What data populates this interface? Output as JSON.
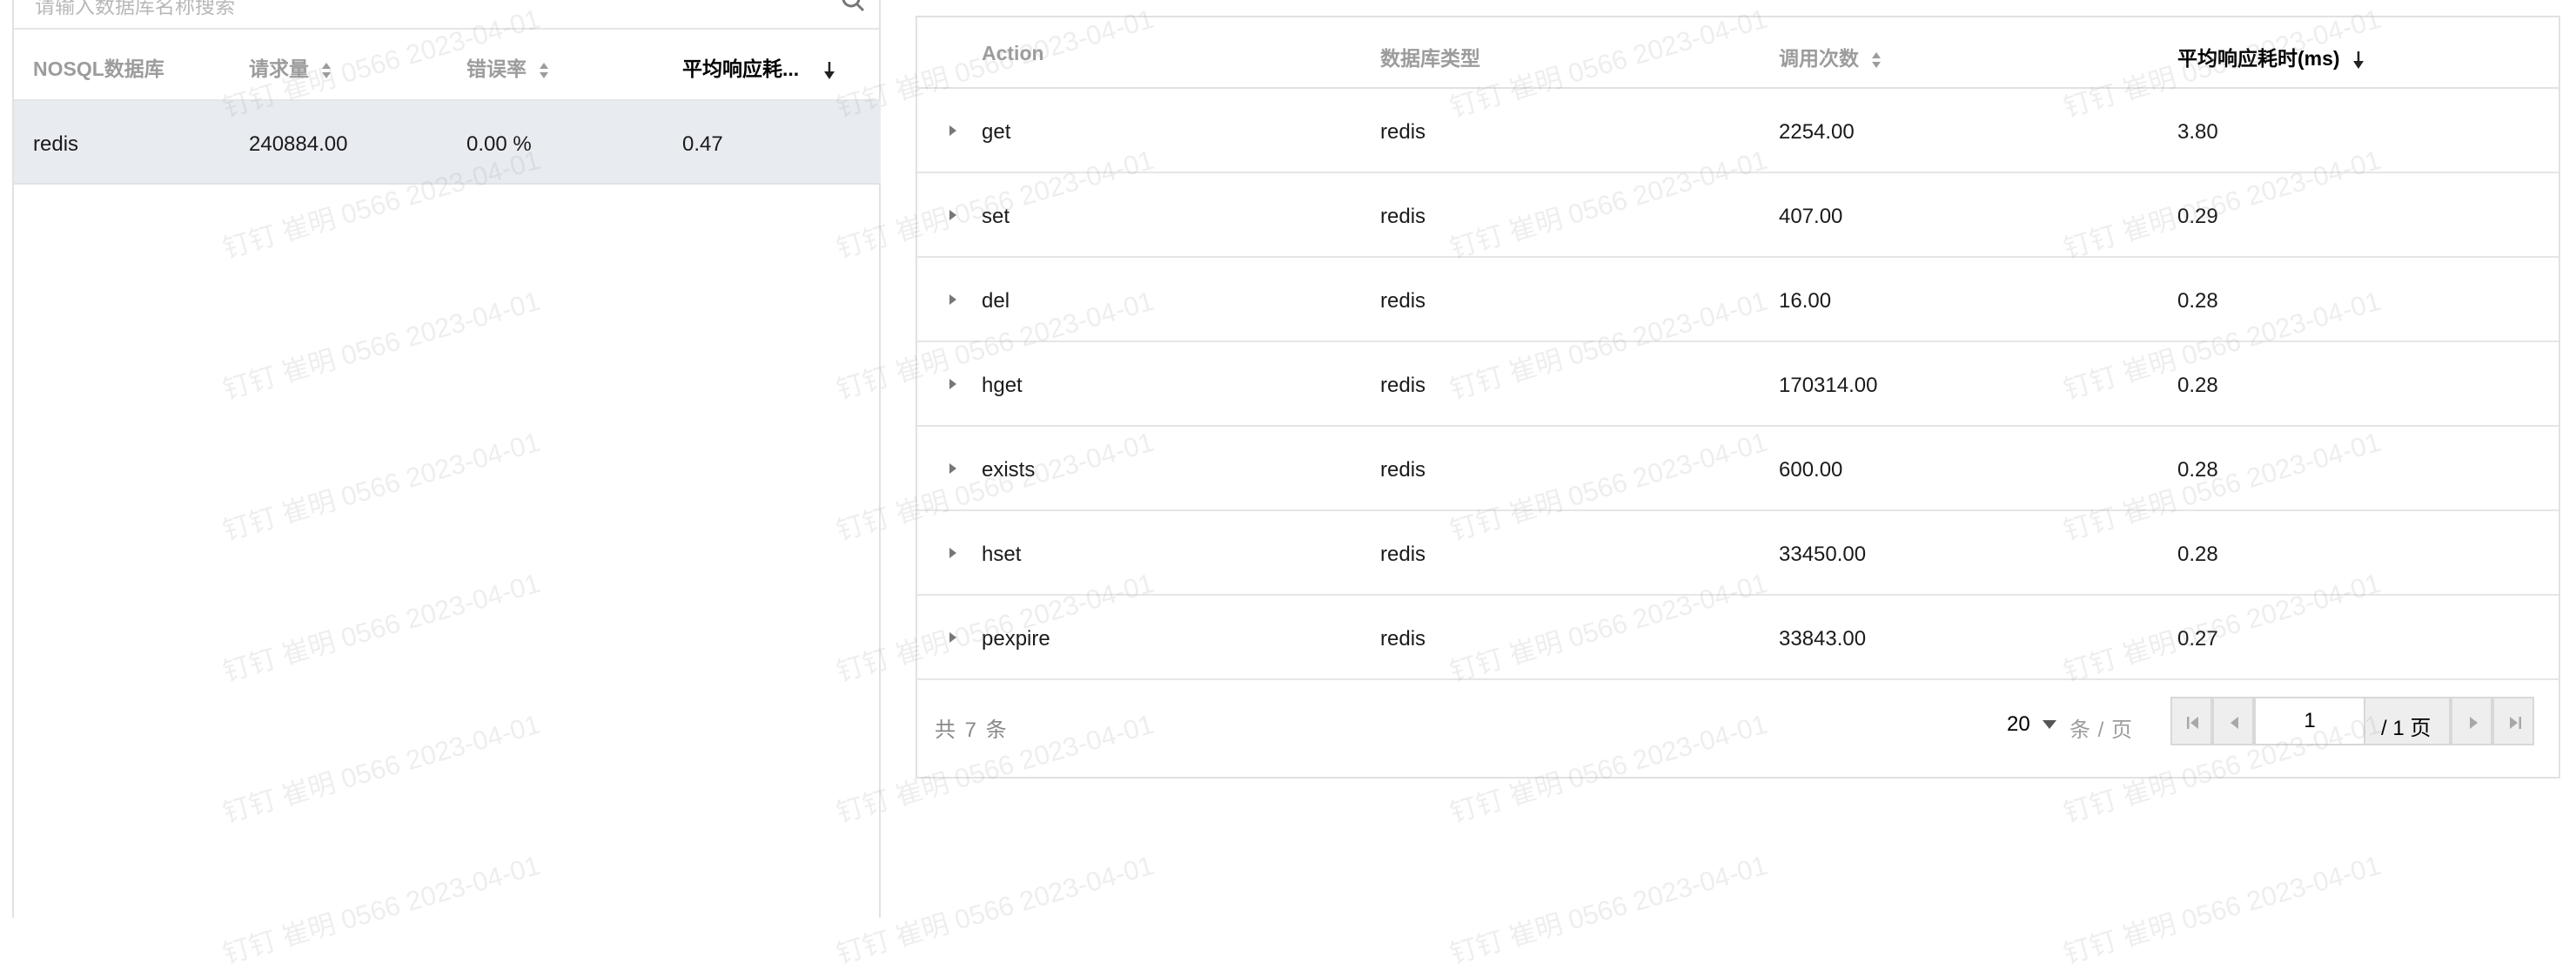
{
  "left": {
    "search_placeholder": "请输入数据库名称搜索",
    "columns": [
      "NOSQL数据库",
      "请求量",
      "错误率",
      "平均响应耗..."
    ],
    "rows": [
      {
        "name": "redis",
        "requests": "240884.00",
        "error_rate": "0.00 %",
        "avg_latency": "0.47"
      }
    ]
  },
  "right": {
    "columns": [
      "Action",
      "数据库类型",
      "调用次数",
      "平均响应耗时(ms)"
    ],
    "rows": [
      {
        "action": "get",
        "db_type": "redis",
        "calls": "2254.00",
        "avg_latency": "3.80"
      },
      {
        "action": "set",
        "db_type": "redis",
        "calls": "407.00",
        "avg_latency": "0.29"
      },
      {
        "action": "del",
        "db_type": "redis",
        "calls": "16.00",
        "avg_latency": "0.28"
      },
      {
        "action": "hget",
        "db_type": "redis",
        "calls": "170314.00",
        "avg_latency": "0.28"
      },
      {
        "action": "exists",
        "db_type": "redis",
        "calls": "600.00",
        "avg_latency": "0.28"
      },
      {
        "action": "hset",
        "db_type": "redis",
        "calls": "33450.00",
        "avg_latency": "0.28"
      },
      {
        "action": "pexpire",
        "db_type": "redis",
        "calls": "33843.00",
        "avg_latency": "0.27"
      }
    ],
    "footer": {
      "total": "共 7 条",
      "page_size": "20",
      "per_page_label": "条 / 页",
      "current_page": "1",
      "page_total": "/ 1 页"
    }
  },
  "watermark": "钉钉 崔明 0566 2023-04-01"
}
